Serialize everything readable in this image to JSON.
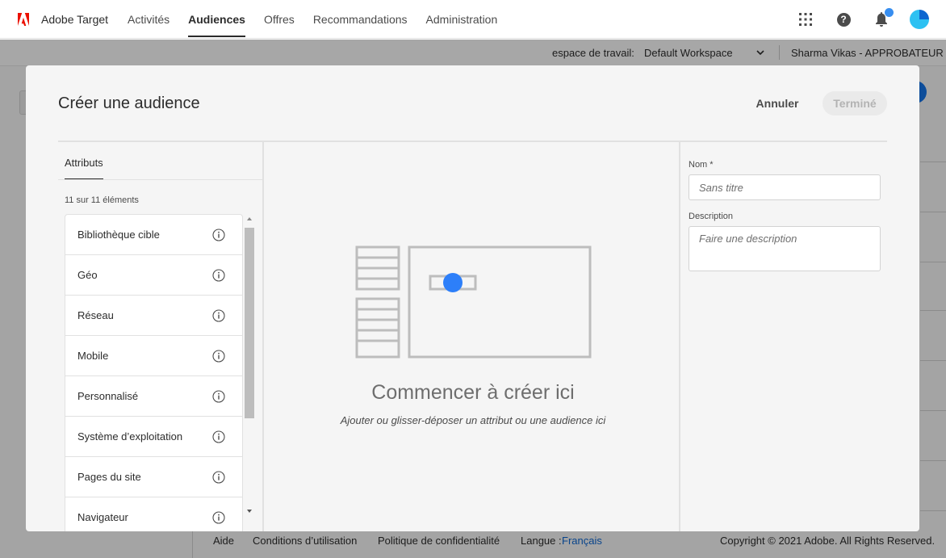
{
  "topnav": {
    "brand": "Adobe Target",
    "links": [
      "Activités",
      "Audiences",
      "Offres",
      "Recommandations",
      "Administration"
    ],
    "active": "Audiences",
    "icons": [
      "apps-grid-icon",
      "help-icon",
      "bell-icon",
      "user-avatar"
    ]
  },
  "subbar": {
    "workspace_label": "espace de travail:",
    "workspace_value": "Default Workspace",
    "user": "Sharma Vikas - APPROBATEUR"
  },
  "modal": {
    "title": "Créer une audience",
    "cancel_label": "Annuler",
    "done_label": "Terminé",
    "tab": "Attributs",
    "count": "11 sur 11 éléments",
    "attributes": [
      "Bibliothèque cible",
      "Géo",
      "Réseau",
      "Mobile",
      "Personnalisé",
      "Système d’exploitation",
      "Pages du site",
      "Navigateur"
    ],
    "empty_title": "Commencer à créer ici",
    "empty_subtitle": "Ajouter ou glisser-déposer un attribut ou une audience ici",
    "name_label": "Nom *",
    "name_placeholder": "Sans titre",
    "description_label": "Description",
    "description_placeholder": "Faire une description"
  },
  "footer": {
    "help": "Aide",
    "terms": "Conditions d’utilisation",
    "privacy": "Politique de confidentialité",
    "language_label": "Langue :",
    "language_value": "Français",
    "copyright": "Copyright © 2021 Adobe. All Rights Reserved."
  },
  "colors": {
    "accent": "#1473e6",
    "brand_red": "#eb1000",
    "drag_dot": "#2d7ff9"
  }
}
